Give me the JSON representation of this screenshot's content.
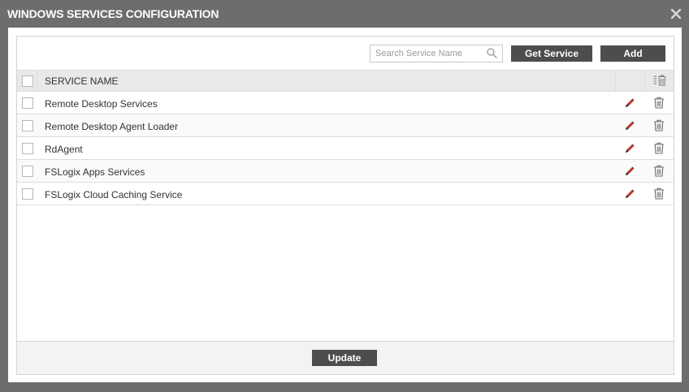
{
  "dialog": {
    "title": "WINDOWS SERVICES CONFIGURATION",
    "close_icon": "close-icon"
  },
  "toolbar": {
    "search_placeholder": "Search Service Name",
    "search_value": "",
    "search_icon": "search-icon",
    "get_service_label": "Get Service",
    "add_label": "Add"
  },
  "table": {
    "header": {
      "name": "SERVICE NAME",
      "bulk_delete_icon": "bulk-delete-icon"
    },
    "rows": [
      {
        "name": "Remote Desktop Services"
      },
      {
        "name": "Remote Desktop Agent Loader"
      },
      {
        "name": "RdAgent"
      },
      {
        "name": "FSLogix Apps Services"
      },
      {
        "name": "FSLogix Cloud Caching Service"
      }
    ]
  },
  "footer": {
    "update_label": "Update"
  },
  "colors": {
    "titlebar": "#6d6d6d",
    "button": "#4d4d4d",
    "header_row": "#e9e9e9",
    "edit_icon": "#c0392b"
  }
}
